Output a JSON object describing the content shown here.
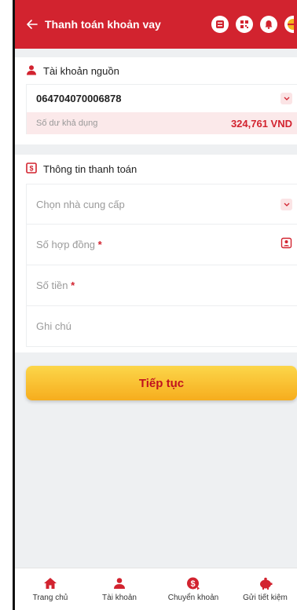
{
  "header": {
    "title": "Thanh toán khoản vay",
    "icons": [
      "contacts-icon",
      "qr-icon",
      "notification-icon",
      "profile-icon"
    ]
  },
  "source_account": {
    "section_title": "Tài khoản nguồn",
    "account_number": "064704070006878",
    "balance_label": "Số dư khả dụng",
    "balance_value": "324,761 VND"
  },
  "payment_info": {
    "section_title": "Thông tin thanh toán",
    "provider_placeholder": "Chọn nhà cung cấp",
    "contract_placeholder": "Số hợp đồng",
    "amount_placeholder": "Số tiền",
    "note_placeholder": "Ghi chú",
    "required_mark": "*"
  },
  "continue_label": "Tiếp tục",
  "bottom_nav": [
    {
      "label": "Trang chủ",
      "icon": "home-icon"
    },
    {
      "label": "Tài khoản",
      "icon": "account-icon"
    },
    {
      "label": "Chuyển khoản",
      "icon": "transfer-icon"
    },
    {
      "label": "Gửi tiết kiệm",
      "icon": "savings-icon"
    }
  ],
  "colors": {
    "brand_red": "#d2232f",
    "button_yellow": "#f8c233",
    "background": "#eef0f2"
  }
}
